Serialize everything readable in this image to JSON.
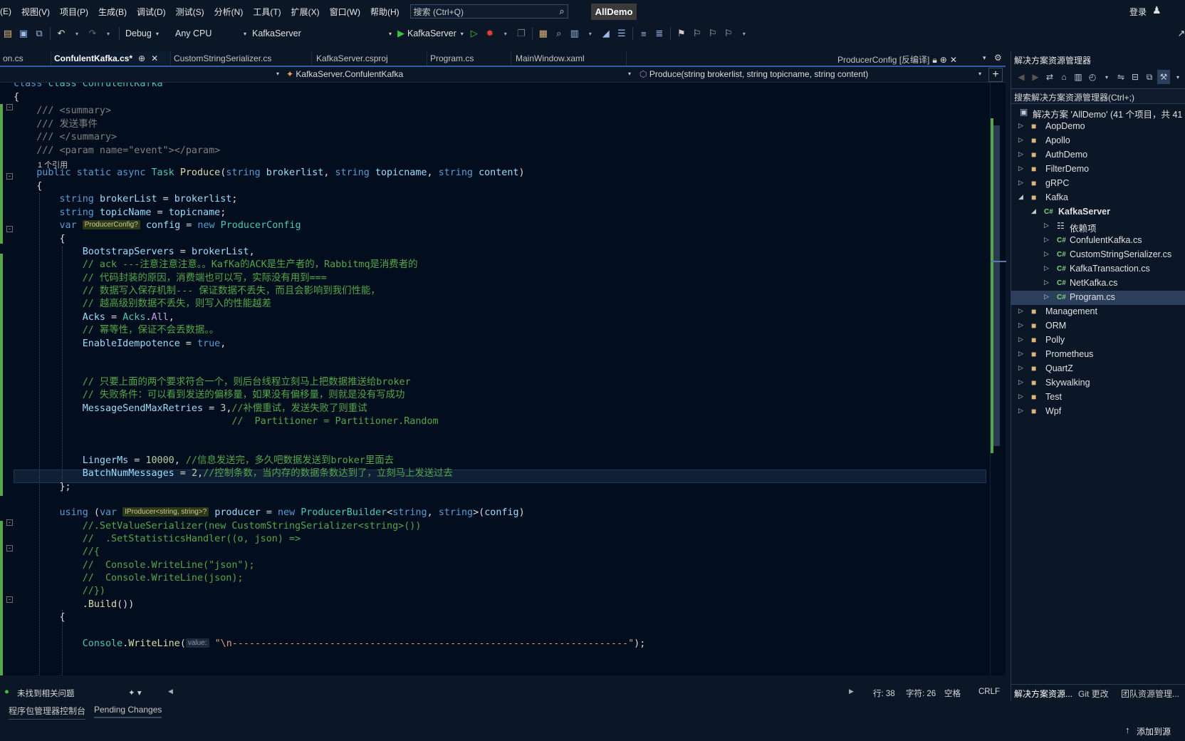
{
  "menu": {
    "items": [
      "(E)",
      "视图(V)",
      "项目(P)",
      "生成(B)",
      "调试(D)",
      "测试(S)",
      "分析(N)",
      "工具(T)",
      "扩展(X)",
      "窗口(W)",
      "帮助(H)"
    ],
    "search_placeholder": "搜索 (Ctrl+Q)",
    "solution_name": "AllDemo",
    "login": "登录"
  },
  "toolbar": {
    "configuration": "Debug",
    "platform": "Any CPU",
    "startup_project": "KafkaServer",
    "run_target": "KafkaServer"
  },
  "tabs": [
    {
      "label": "on.cs"
    },
    {
      "label": "ConfulentKafka.cs*",
      "active": true
    },
    {
      "label": "CustomStringSerializer.cs"
    },
    {
      "label": "KafkaServer.csproj"
    },
    {
      "label": "Program.cs"
    },
    {
      "label": "MainWindow.xaml"
    },
    {
      "label": "ProducerConfig [反编译]"
    }
  ],
  "nav": {
    "type_scope": "KafkaServer.ConfulentKafka",
    "member_scope": "Produce(string brokerlist, string topicname, string content)"
  },
  "editor": {
    "ref_count": "1 个引用",
    "status": {
      "issues": "未找到相关问题",
      "line": "行: 38",
      "col": "字符: 26",
      "whitespace": "空格",
      "eol": "CRLF"
    }
  },
  "bottom_tabs": [
    "程序包管理器控制台",
    "Pending Changes"
  ],
  "solution_explorer": {
    "title": "解决方案资源管理器",
    "search": "搜索解决方案资源管理器(Ctrl+;)",
    "root": "解决方案 'AllDemo' (41 个项目，共 41",
    "nodes": [
      {
        "label": "AopDemo"
      },
      {
        "label": "Apollo"
      },
      {
        "label": "AuthDemo"
      },
      {
        "label": "FilterDemo"
      },
      {
        "label": "gRPC"
      },
      {
        "label": "Kafka"
      },
      {
        "label": "KafkaServer"
      },
      {
        "label": "依赖项"
      },
      {
        "label": "ConfulentKafka.cs"
      },
      {
        "label": "CustomStringSerializer.cs"
      },
      {
        "label": "KafkaTransaction.cs"
      },
      {
        "label": "NetKafka.cs"
      },
      {
        "label": "Program.cs"
      },
      {
        "label": "Management"
      },
      {
        "label": "ORM"
      },
      {
        "label": "Polly"
      },
      {
        "label": "Prometheus"
      },
      {
        "label": "QuartZ"
      },
      {
        "label": "Skywalking"
      },
      {
        "label": "Test"
      },
      {
        "label": "Wpf"
      }
    ],
    "bottom_tabs": [
      "解决方案资源...",
      "Git 更改",
      "团队资源管理..."
    ]
  },
  "status_strip": {
    "add_to_source": "添加到源"
  },
  "code": {
    "l1": "class ConfulentKafka",
    "c_summary_open": "/// <summary>",
    "c_summary_text": "/// 发送事件",
    "c_summary_close": "/// </summary>",
    "c_param": "/// <param name=\"event\"></param>",
    "c_ack": "// ack ---注意注意注意。。KafKa的ACK是生产者的，Rabbitmq是消费者的",
    "c_code_reason": "// 代码封装的原因，消费端也可以写，实际没有用到===",
    "c_persist": "// 数据写入保存机制--- 保证数据不丢失，而且会影响到我们性能，",
    "c_higher": "// 越高级别数据不丢失，则写入的性能越差",
    "c_idem": "// 幂等性，保证不会丢数据。。",
    "c_one": "// 只要上面的两个要求符合一个，则后台线程立刻马上把数据推送给broker",
    "c_fail": "// 失败条件：可以看到发送的偏移量，如果没有偏移量，则就是没有写成功",
    "c_retry": "//补偿重试，发送失败了则重试",
    "c_partitioner": "//  Partitioner = Partitioner.Random",
    "c_linger": "//信息发送完，多久吧数据发送到broker里面去",
    "c_batch": "//控制条数，当内存的数据条数达到了，立刻马上发送过去",
    "c_setser": "//.SetValueSerializer(new CustomStringSerializer<string>())",
    "c_setstat": "//  .SetStatisticsHandler((o, json) =>",
    "c_brace": "//{",
    "c_cw1": "//  Console.WriteLine(\"json\");",
    "c_cw2": "//  Console.WriteLine(json);",
    "c_close": "//})",
    "hint_producer_config": "ProducerConfig?",
    "hint_iproducer": "IProducer<string, string>?",
    "hint_value": "value:",
    "s_dashes": "\"\\n---------------------------------------------------------------------\""
  }
}
